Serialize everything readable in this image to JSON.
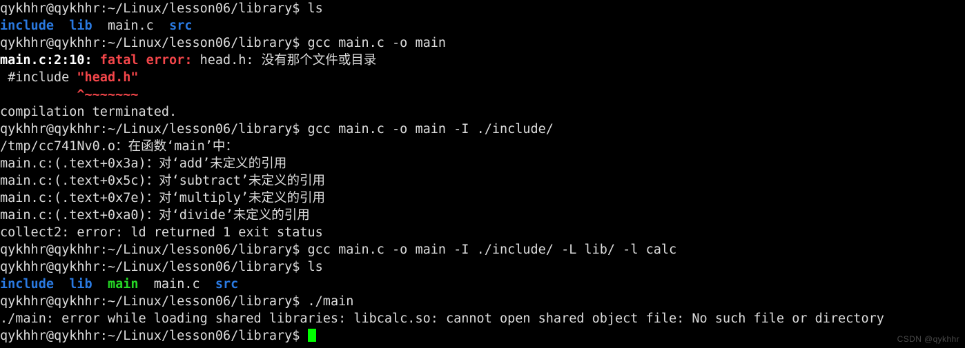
{
  "terminal": {
    "background_color": "#000000",
    "foreground_color": "#dcdcdc",
    "colors": {
      "directory_blue": "#2a7ae2",
      "executable_green": "#26d826",
      "error_red": "#f4464a",
      "cursor_green": "#00ff00",
      "watermark_grey": "#4a4a4a"
    },
    "prompt": "qykhhr@qykhhr:~/Linux/lesson06/library$ ",
    "user": "qykhhr",
    "host": "qykhhr",
    "cwd": "~/Linux/lesson06/library",
    "lines": [
      {
        "id": "line-1-prompt-ls",
        "segments": [
          {
            "text": "qykhhr@qykhhr:~/Linux/lesson06/library$ ",
            "style": "c-white"
          },
          {
            "text": "ls",
            "style": "c-white"
          }
        ]
      },
      {
        "id": "line-2-ls-output",
        "segments": [
          {
            "text": "include",
            "style": "c-blue"
          },
          {
            "text": "  ",
            "style": "c-white"
          },
          {
            "text": "lib",
            "style": "c-blue"
          },
          {
            "text": "  ",
            "style": "c-white"
          },
          {
            "text": "main.c",
            "style": "c-white"
          },
          {
            "text": "  ",
            "style": "c-white"
          },
          {
            "text": "src",
            "style": "c-blue"
          }
        ]
      },
      {
        "id": "line-3-prompt-gcc",
        "segments": [
          {
            "text": "qykhhr@qykhhr:~/Linux/lesson06/library$ ",
            "style": "c-white"
          },
          {
            "text": "gcc main.c -o main",
            "style": "c-white"
          }
        ]
      },
      {
        "id": "line-4-fatal-error",
        "segments": [
          {
            "text": "main.c:2:10:",
            "style": "c-bwhite"
          },
          {
            "text": " ",
            "style": "c-white"
          },
          {
            "text": "fatal error:",
            "style": "c-bred"
          },
          {
            "text": " head.h: 没有那个文件或目录",
            "style": "c-white"
          }
        ]
      },
      {
        "id": "line-5-include-source",
        "segments": [
          {
            "text": " #include ",
            "style": "c-white"
          },
          {
            "text": "\"head.h\"",
            "style": "c-bred"
          }
        ]
      },
      {
        "id": "line-6-caret-marker",
        "segments": [
          {
            "text": "          ",
            "style": "c-white"
          },
          {
            "text": "^~~~~~~~",
            "style": "c-bred"
          }
        ]
      },
      {
        "id": "line-7-compilation-terminated",
        "segments": [
          {
            "text": "compilation terminated.",
            "style": "c-white"
          }
        ]
      },
      {
        "id": "line-8-prompt-gcc-include",
        "segments": [
          {
            "text": "qykhhr@qykhhr:~/Linux/lesson06/library$ ",
            "style": "c-white"
          },
          {
            "text": "gcc main.c -o main -I ./include/",
            "style": "c-white"
          }
        ]
      },
      {
        "id": "line-9-tmp-object",
        "segments": [
          {
            "text": "/tmp/cc741Nv0.o：在函数‘main’中：",
            "style": "c-white"
          }
        ]
      },
      {
        "id": "line-10-undef-add",
        "segments": [
          {
            "text": "main.c:(.text+0x3a)：对‘add’未定义的引用",
            "style": "c-white"
          }
        ]
      },
      {
        "id": "line-11-undef-subtract",
        "segments": [
          {
            "text": "main.c:(.text+0x5c)：对‘subtract’未定义的引用",
            "style": "c-white"
          }
        ]
      },
      {
        "id": "line-12-undef-multiply",
        "segments": [
          {
            "text": "main.c:(.text+0x7e)：对‘multiply’未定义的引用",
            "style": "c-white"
          }
        ]
      },
      {
        "id": "line-13-undef-divide",
        "segments": [
          {
            "text": "main.c:(.text+0xa0)：对‘divide’未定义的引用",
            "style": "c-white"
          }
        ]
      },
      {
        "id": "line-14-collect2",
        "segments": [
          {
            "text": "collect2: error: ld returned 1 exit status",
            "style": "c-white"
          }
        ]
      },
      {
        "id": "line-15-prompt-gcc-full",
        "segments": [
          {
            "text": "qykhhr@qykhhr:~/Linux/lesson06/library$ ",
            "style": "c-white"
          },
          {
            "text": "gcc main.c -o main -I ./include/ -L lib/ -l calc",
            "style": "c-white"
          }
        ]
      },
      {
        "id": "line-16-prompt-ls-2",
        "segments": [
          {
            "text": "qykhhr@qykhhr:~/Linux/lesson06/library$ ",
            "style": "c-white"
          },
          {
            "text": "ls",
            "style": "c-white"
          }
        ]
      },
      {
        "id": "line-17-ls-output-2",
        "segments": [
          {
            "text": "include",
            "style": "c-blue"
          },
          {
            "text": "  ",
            "style": "c-white"
          },
          {
            "text": "lib",
            "style": "c-blue"
          },
          {
            "text": "  ",
            "style": "c-white"
          },
          {
            "text": "main",
            "style": "c-green"
          },
          {
            "text": "  ",
            "style": "c-white"
          },
          {
            "text": "main.c",
            "style": "c-white"
          },
          {
            "text": "  ",
            "style": "c-white"
          },
          {
            "text": "src",
            "style": "c-blue"
          }
        ]
      },
      {
        "id": "line-18-prompt-run-main",
        "segments": [
          {
            "text": "qykhhr@qykhhr:~/Linux/lesson06/library$ ",
            "style": "c-white"
          },
          {
            "text": "./main",
            "style": "c-white"
          }
        ]
      },
      {
        "id": "line-19-shared-lib-error",
        "segments": [
          {
            "text": "./main: error while loading shared libraries: libcalc.so: cannot open shared object file: No such file or directory",
            "style": "c-white"
          }
        ]
      },
      {
        "id": "line-20-final-prompt",
        "segments": [
          {
            "text": "qykhhr@qykhhr:~/Linux/lesson06/library$ ",
            "style": "c-white"
          }
        ],
        "cursor": true
      }
    ]
  },
  "watermark": {
    "text": "CSDN @qykhhr"
  }
}
